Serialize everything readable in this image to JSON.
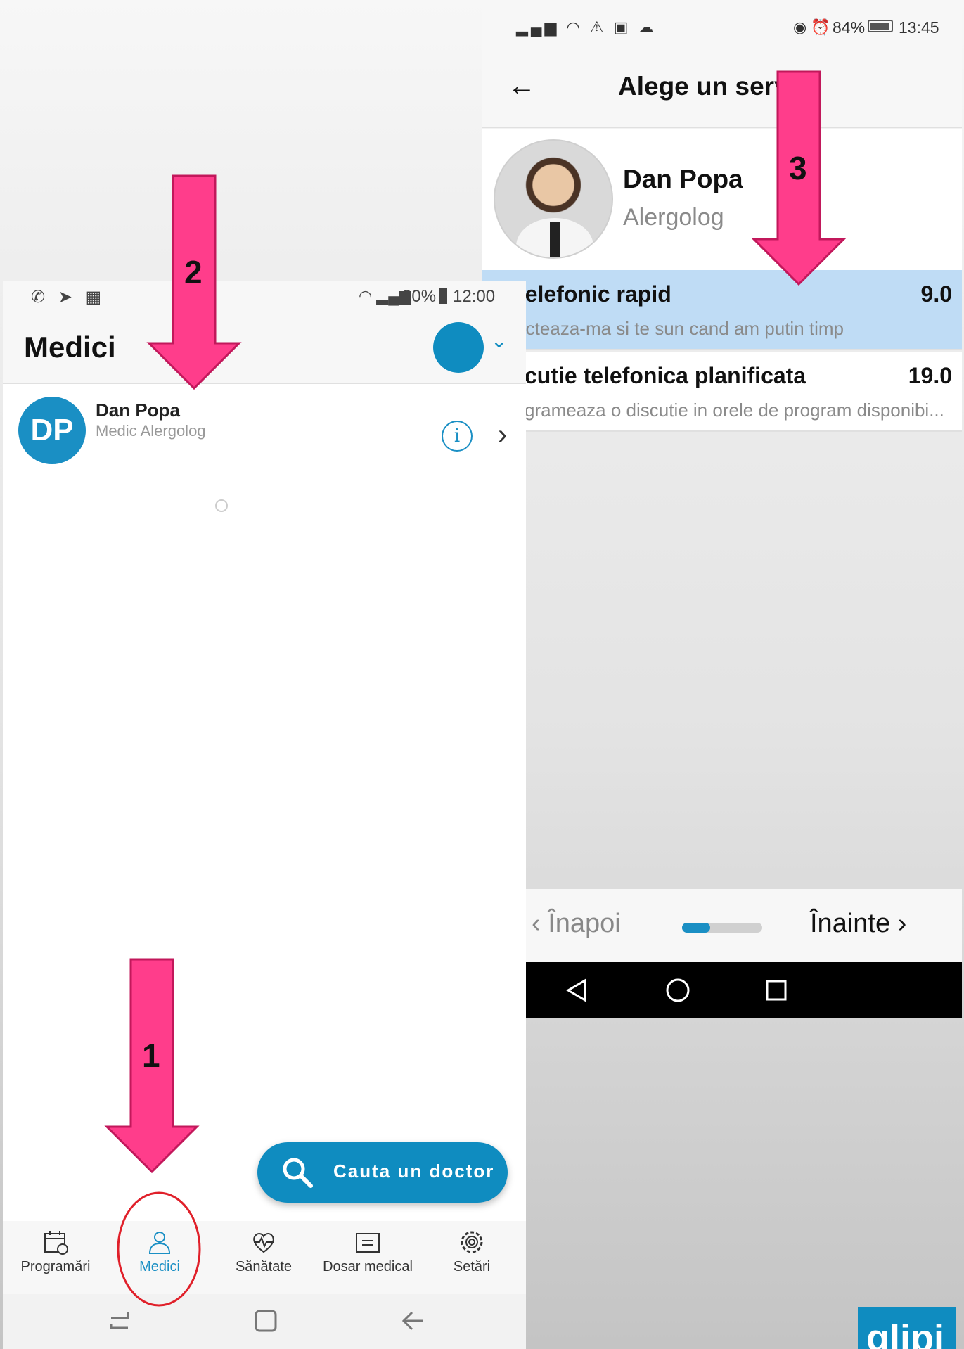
{
  "right_screen": {
    "status_bar": {
      "battery": "84%",
      "time": "13:45"
    },
    "title": "Alege un serv",
    "doctor": {
      "name": "Dan Popa",
      "specialty": "Alergolog"
    },
    "services": [
      {
        "title": "Sfat telefonic rapid",
        "title_visible": "' t telefonic rapid",
        "description": "tacteaza-ma si te sun cand am putin timp",
        "price": "9.0",
        "selected": true
      },
      {
        "title": "cutie telefonica planificata",
        "title_visible": "cutie telefonica planificata",
        "description": "grameaza o discutie in orele de program disponibi...",
        "price": "19.0",
        "selected": false
      }
    ],
    "nav": {
      "back_label": "Înapoi",
      "next_label": "Înainte",
      "progress": 0.35
    }
  },
  "left_screen": {
    "status_bar": {
      "battery": "80%",
      "time": "12:00"
    },
    "title": "Medici",
    "doctor": {
      "initials": "DP",
      "name": "Dan Popa",
      "specialty": "Medic Alergolog"
    },
    "search_button": "Cauta un doctor",
    "tabs": [
      {
        "label": "Programări",
        "icon": "calendar-icon"
      },
      {
        "label": "Medici",
        "icon": "doctor-icon",
        "active": true
      },
      {
        "label": "Sănătate",
        "icon": "heart-pulse-icon"
      },
      {
        "label": "Dosar medical",
        "icon": "folder-icon"
      },
      {
        "label": "Setări",
        "icon": "gear-icon"
      }
    ]
  },
  "annotations": {
    "step1": "1",
    "step2": "2",
    "step3": "3"
  },
  "logo_text": "glipi",
  "colors": {
    "accent": "#0f8cc0",
    "selected_row": "#bfdcf5",
    "arrow": "#ff3d8b"
  }
}
